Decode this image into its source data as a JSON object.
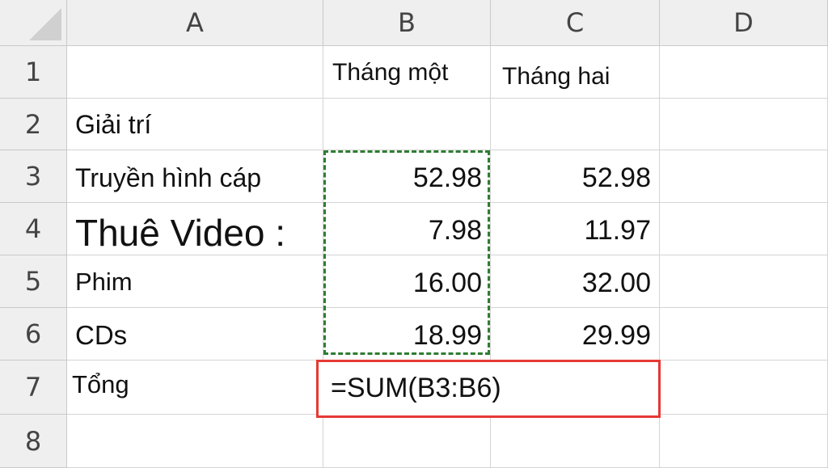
{
  "columns": [
    "A",
    "B",
    "C",
    "D"
  ],
  "rows": [
    "1",
    "2",
    "3",
    "4",
    "5",
    "6",
    "7",
    "8"
  ],
  "cells": {
    "B1": "Tháng một",
    "C1": "Tháng hai",
    "A2": "Giải trí",
    "A3": "Truyền hình cáp",
    "B3": "52.98",
    "C3": "52.98",
    "A4": "Thuê Video :",
    "B4": "7.98",
    "C4": "11.97",
    "A5": "Phim",
    "B5": "16.00",
    "C5": "32.00",
    "A6": "CDs",
    "B6": "18.99",
    "C6": "29.99",
    "A7": "Tổng",
    "B7": "=SUM(B3:B6)"
  },
  "colors": {
    "marquee": "#2e7d32",
    "active_cell_border": "#e53935",
    "header_bg": "#efefef",
    "gridline": "#d4d4d4"
  },
  "icons": {
    "corner": "select-all-triangle-icon"
  }
}
